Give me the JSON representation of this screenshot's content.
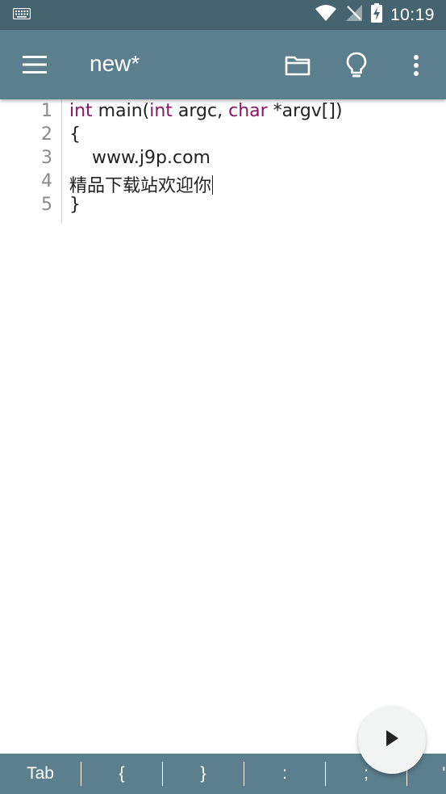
{
  "status_bar": {
    "time": "10:19",
    "icons": [
      "keyboard-icon",
      "wifi-icon",
      "no-signal-icon",
      "battery-charging-icon"
    ]
  },
  "app_bar": {
    "title": "new*",
    "icons": [
      "menu-icon",
      "folder-icon",
      "lightbulb-icon",
      "more-vert-icon"
    ]
  },
  "editor": {
    "line_numbers": [
      "1",
      "2",
      "3",
      "4",
      "5"
    ],
    "lines": [
      [
        {
          "text": "int",
          "kw": true
        },
        {
          "text": " main(",
          "kw": false
        },
        {
          "text": "int",
          "kw": true
        },
        {
          "text": " argc, ",
          "kw": false
        },
        {
          "text": "char",
          "kw": true
        },
        {
          "text": " *argv[])",
          "kw": false
        }
      ],
      [
        {
          "text": "{",
          "kw": false
        }
      ],
      [
        {
          "text": "    www.j9p.com",
          "kw": false
        }
      ],
      [
        {
          "text": "精品下载站欢迎你",
          "kw": false
        }
      ],
      [
        {
          "text": "}",
          "kw": false
        }
      ]
    ],
    "cursor_line": 4
  },
  "fab": {
    "icon": "play-icon"
  },
  "symbol_bar": {
    "keys": [
      "Tab",
      "{",
      "}",
      ":",
      ";",
      "\""
    ]
  },
  "colors": {
    "status_bar": "#466470",
    "app_bar": "#5c7f8d",
    "keyword": "#8b1466"
  }
}
